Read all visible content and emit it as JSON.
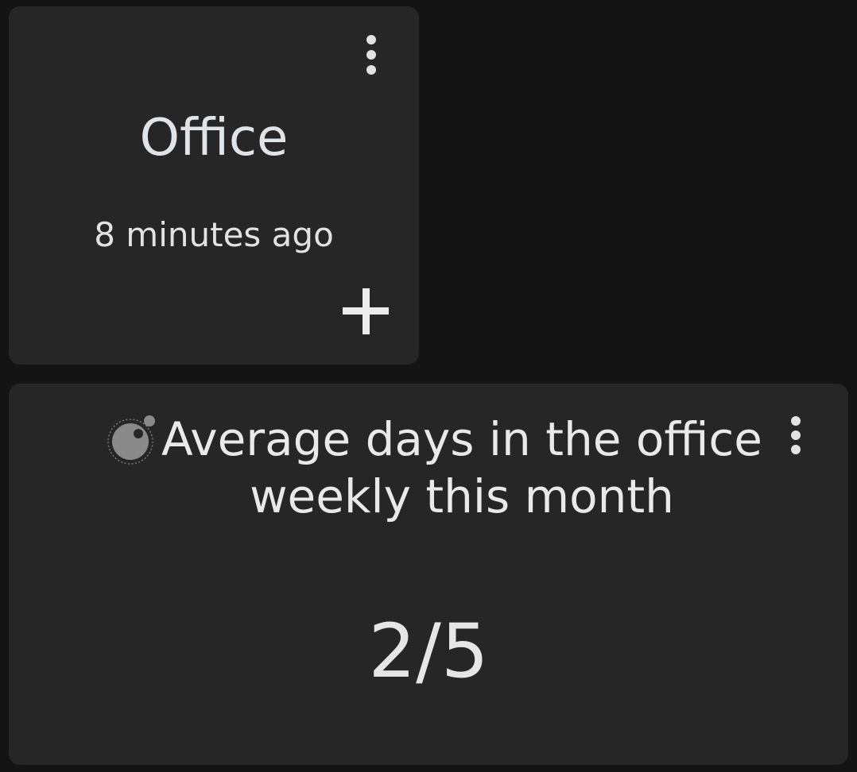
{
  "office_card": {
    "title": "Office",
    "last_updated": "8 minutes ago",
    "menu_icon": "more-vertical-icon",
    "add_icon": "plus-icon"
  },
  "average_card": {
    "title": "Average days in the office weekly this month",
    "value": "2/5",
    "logo_icon": "orb-logo-icon",
    "menu_icon": "more-vertical-icon"
  },
  "colors": {
    "page_background": "#141414",
    "card_background": "#262626",
    "text_primary": "#e6e6e6"
  }
}
